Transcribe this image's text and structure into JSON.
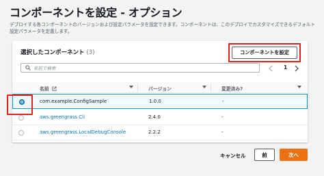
{
  "page": {
    "title": "コンポーネントを設定 - オプション",
    "description": "デプロイする各コンポーネントのバージョンおよび設定パラメータを設定できます。コンポーネントは、このデプロイでカスタマイズできるデフォルト設定パラメータを定義します。"
  },
  "panel": {
    "title": "選択したコンポーネント",
    "count": "(3)",
    "configure_button": "コンポーネントを設定",
    "search_placeholder": "名前で検索",
    "page_number": "1"
  },
  "table": {
    "headers": {
      "name": "名前",
      "version": "バージョン",
      "modified": "変更済み?"
    },
    "rows": [
      {
        "name": "com.example.ConfigSample",
        "version": "1.0.0",
        "modified": "-",
        "selected": true
      },
      {
        "name": "aws.greengrass.Cli",
        "version": "2.4.0",
        "modified": "-",
        "selected": false
      },
      {
        "name": "aws.greengrass.LocalDebugConsole",
        "version": "2.2.2",
        "modified": "-",
        "selected": false
      }
    ]
  },
  "footer": {
    "cancel": "キャンセル",
    "back": "前",
    "next": "次へ"
  },
  "colors": {
    "primary": "#ec7211",
    "link": "#0073bb",
    "highlight": "#e0201b"
  },
  "icons": [
    "search-icon",
    "external-link-icon",
    "sort-caret-icon",
    "chevron-left-icon",
    "chevron-right-icon"
  ]
}
